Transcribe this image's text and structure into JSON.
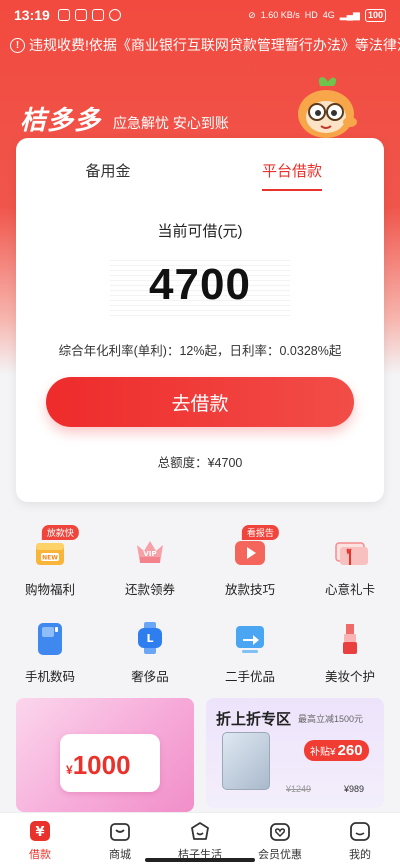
{
  "status_bar": {
    "time": "13:19",
    "network_speed": "1.60 KB/s",
    "signal": "4G",
    "battery": "100"
  },
  "marquee": {
    "text": "违规收费!依据《商业银行互联网贷款管理暂行办法》等法律法规"
  },
  "brand": {
    "logo": "桔多多",
    "slogan": "应急解忧 安心到账"
  },
  "tabs": [
    {
      "label": "备用金",
      "active": false
    },
    {
      "label": "平台借款",
      "active": true
    }
  ],
  "loan": {
    "available_label": "当前可借(元)",
    "amount": "4700",
    "rate_text": "综合年化利率(单利)：12%起，日利率：0.0328%起",
    "borrow_button": "去借款",
    "total_text": "总额度：¥4700"
  },
  "grid": [
    {
      "label": "购物福利",
      "icon": "gift-box-new-icon",
      "badge": "放款快"
    },
    {
      "label": "还款领券",
      "icon": "vip-crown-icon",
      "badge": ""
    },
    {
      "label": "放款技巧",
      "icon": "video-play-icon",
      "badge": "看报告"
    },
    {
      "label": "心意礼卡",
      "icon": "gift-card-icon",
      "badge": ""
    },
    {
      "label": "手机数码",
      "icon": "phone-icon",
      "badge": ""
    },
    {
      "label": "奢侈品",
      "icon": "watch-icon",
      "badge": ""
    },
    {
      "label": "二手优品",
      "icon": "arrow-box-icon",
      "badge": ""
    },
    {
      "label": "美妆个护",
      "icon": "lipstick-icon",
      "badge": ""
    }
  ],
  "banner_left": {
    "value": "1000",
    "currency": "¥"
  },
  "banner_right": {
    "title": "折上折专区",
    "subtitle": "最高立减1500元",
    "subsidy_label": "补贴¥",
    "subsidy_value": "260",
    "old_price": "¥1249",
    "new_price": "¥989"
  },
  "tab_bar": [
    {
      "label": "借款",
      "icon": "yen-icon",
      "active": true
    },
    {
      "label": "商城",
      "icon": "shopping-bag-icon",
      "active": false
    },
    {
      "label": "桔子生活",
      "icon": "orange-smile-icon",
      "active": false
    },
    {
      "label": "会员优惠",
      "icon": "heart-bag-icon",
      "active": false
    },
    {
      "label": "我的",
      "icon": "profile-icon",
      "active": false
    }
  ],
  "colors": {
    "brand_red": "#e8322b",
    "hero_red": "#f24a3f"
  }
}
